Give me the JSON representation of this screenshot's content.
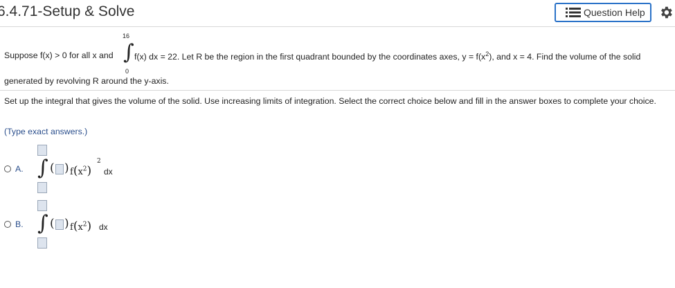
{
  "header": {
    "title": "6.4.71-Setup & Solve",
    "help_label": "Question Help"
  },
  "question": {
    "intro": "Suppose f(x) > 0 for all x and",
    "upper_limit": "16",
    "lower_limit": "0",
    "integrand": "f(x) dx = 22. Let R be the region in the first quadrant bounded by the coordinates axes, y = f(x",
    "exp": "2",
    "tail": "), and x = 4. Find the volume of the solid",
    "line2": "generated by revolving R around the y-axis."
  },
  "instructions": "Set up the integral that gives the volume of the solid. Use increasing limits of integration. Select the correct choice below and fill in the answer boxes to complete your choice.",
  "type_exact": "(Type exact answers.)",
  "choices": [
    {
      "label": "A.",
      "f": "f",
      "x": "x",
      "inner_exp": "2",
      "outer_exp": "2",
      "dx": "dx"
    },
    {
      "label": "B.",
      "f": "f",
      "x": "x",
      "inner_exp": "2",
      "dx": "dx"
    }
  ]
}
